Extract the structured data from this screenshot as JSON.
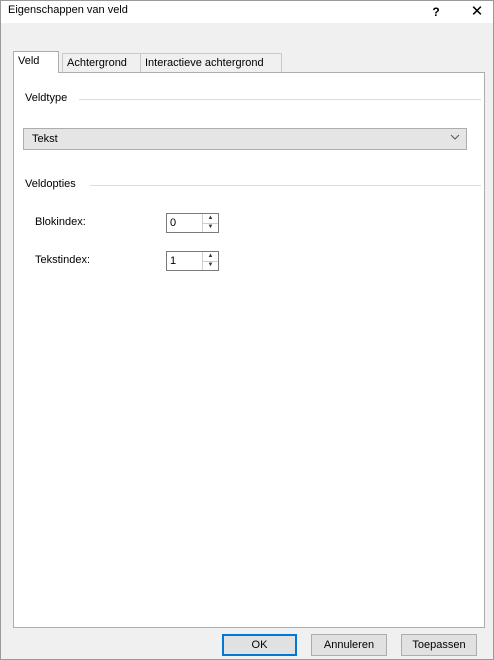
{
  "window": {
    "title": "Eigenschappen van veld",
    "help_label": "?",
    "close_label": "✕"
  },
  "tabs": [
    {
      "label": "Veld",
      "active": true
    },
    {
      "label": "Achtergrond",
      "active": false
    },
    {
      "label": "Interactieve achtergrond",
      "active": false
    }
  ],
  "veldtype": {
    "group_label": "Veldtype",
    "selected": "Tekst",
    "arrow_icon": "chevron-down-icon"
  },
  "veldopties": {
    "group_label": "Veldopties",
    "blokindex_label": "Blokindex:",
    "blokindex_value": "0",
    "tekstindex_label": "Tekstindex:",
    "tekstindex_value": "1"
  },
  "buttons": {
    "ok": "OK",
    "cancel": "Annuleren",
    "apply": "Toepassen"
  },
  "colors": {
    "accent": "#0078d7",
    "dialog_bg": "#f0f0f0",
    "panel_bg": "#ffffff"
  }
}
